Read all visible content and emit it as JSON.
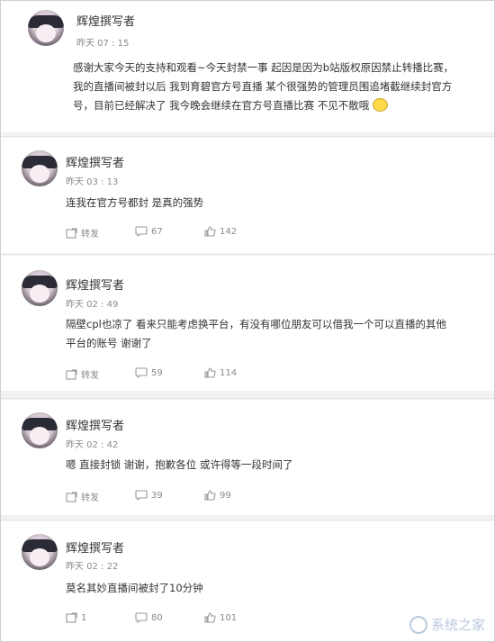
{
  "posts": [
    {
      "author": "辉煌撰写者",
      "time": "昨天 07 : 15",
      "lines": [
        "感谢大家今天的支持和观看~今天封禁一事    起因是因为b站版权原因禁止转播比赛，",
        "我的直播间被封以后   我到育碧官方号直播   某个很强势的管理员围追堵截继续封官方",
        "号，目前已经解决了 我今晚会继续在官方号直播比赛 不见不散哦"
      ]
    },
    {
      "author": "辉煌撰写者",
      "time": "昨天 03 : 13",
      "lines": [
        "连我在官方号都封 是真的强势"
      ],
      "repost_label": "转发",
      "comments": "67",
      "likes": "142"
    },
    {
      "author": "辉煌撰写者",
      "time": "昨天 02 : 49",
      "lines": [
        "隔壁cpl也凉了   看来只能考虑换平台，有没有哪位朋友可以借我一个可以直播的其他",
        "平台的账号 谢谢了"
      ],
      "repost_label": "转发",
      "comments": "59",
      "likes": "114"
    },
    {
      "author": "辉煌撰写者",
      "time": "昨天 02 : 42",
      "lines": [
        "嗯 直接封锁 谢谢，抱歉各位 或许得等一段时间了"
      ],
      "repost_label": "转发",
      "comments": "39",
      "likes": "99"
    },
    {
      "author": "辉煌撰写者",
      "time": "昨天 02 : 22",
      "lines": [
        "莫名其妙直播间被封了10分钟"
      ],
      "repost_label": "1",
      "comments": "80",
      "likes": "101"
    }
  ],
  "watermark": "系统之家",
  "icons": {
    "repost": "repost-icon",
    "comment": "comment-icon",
    "like": "thumbs-up-icon"
  }
}
